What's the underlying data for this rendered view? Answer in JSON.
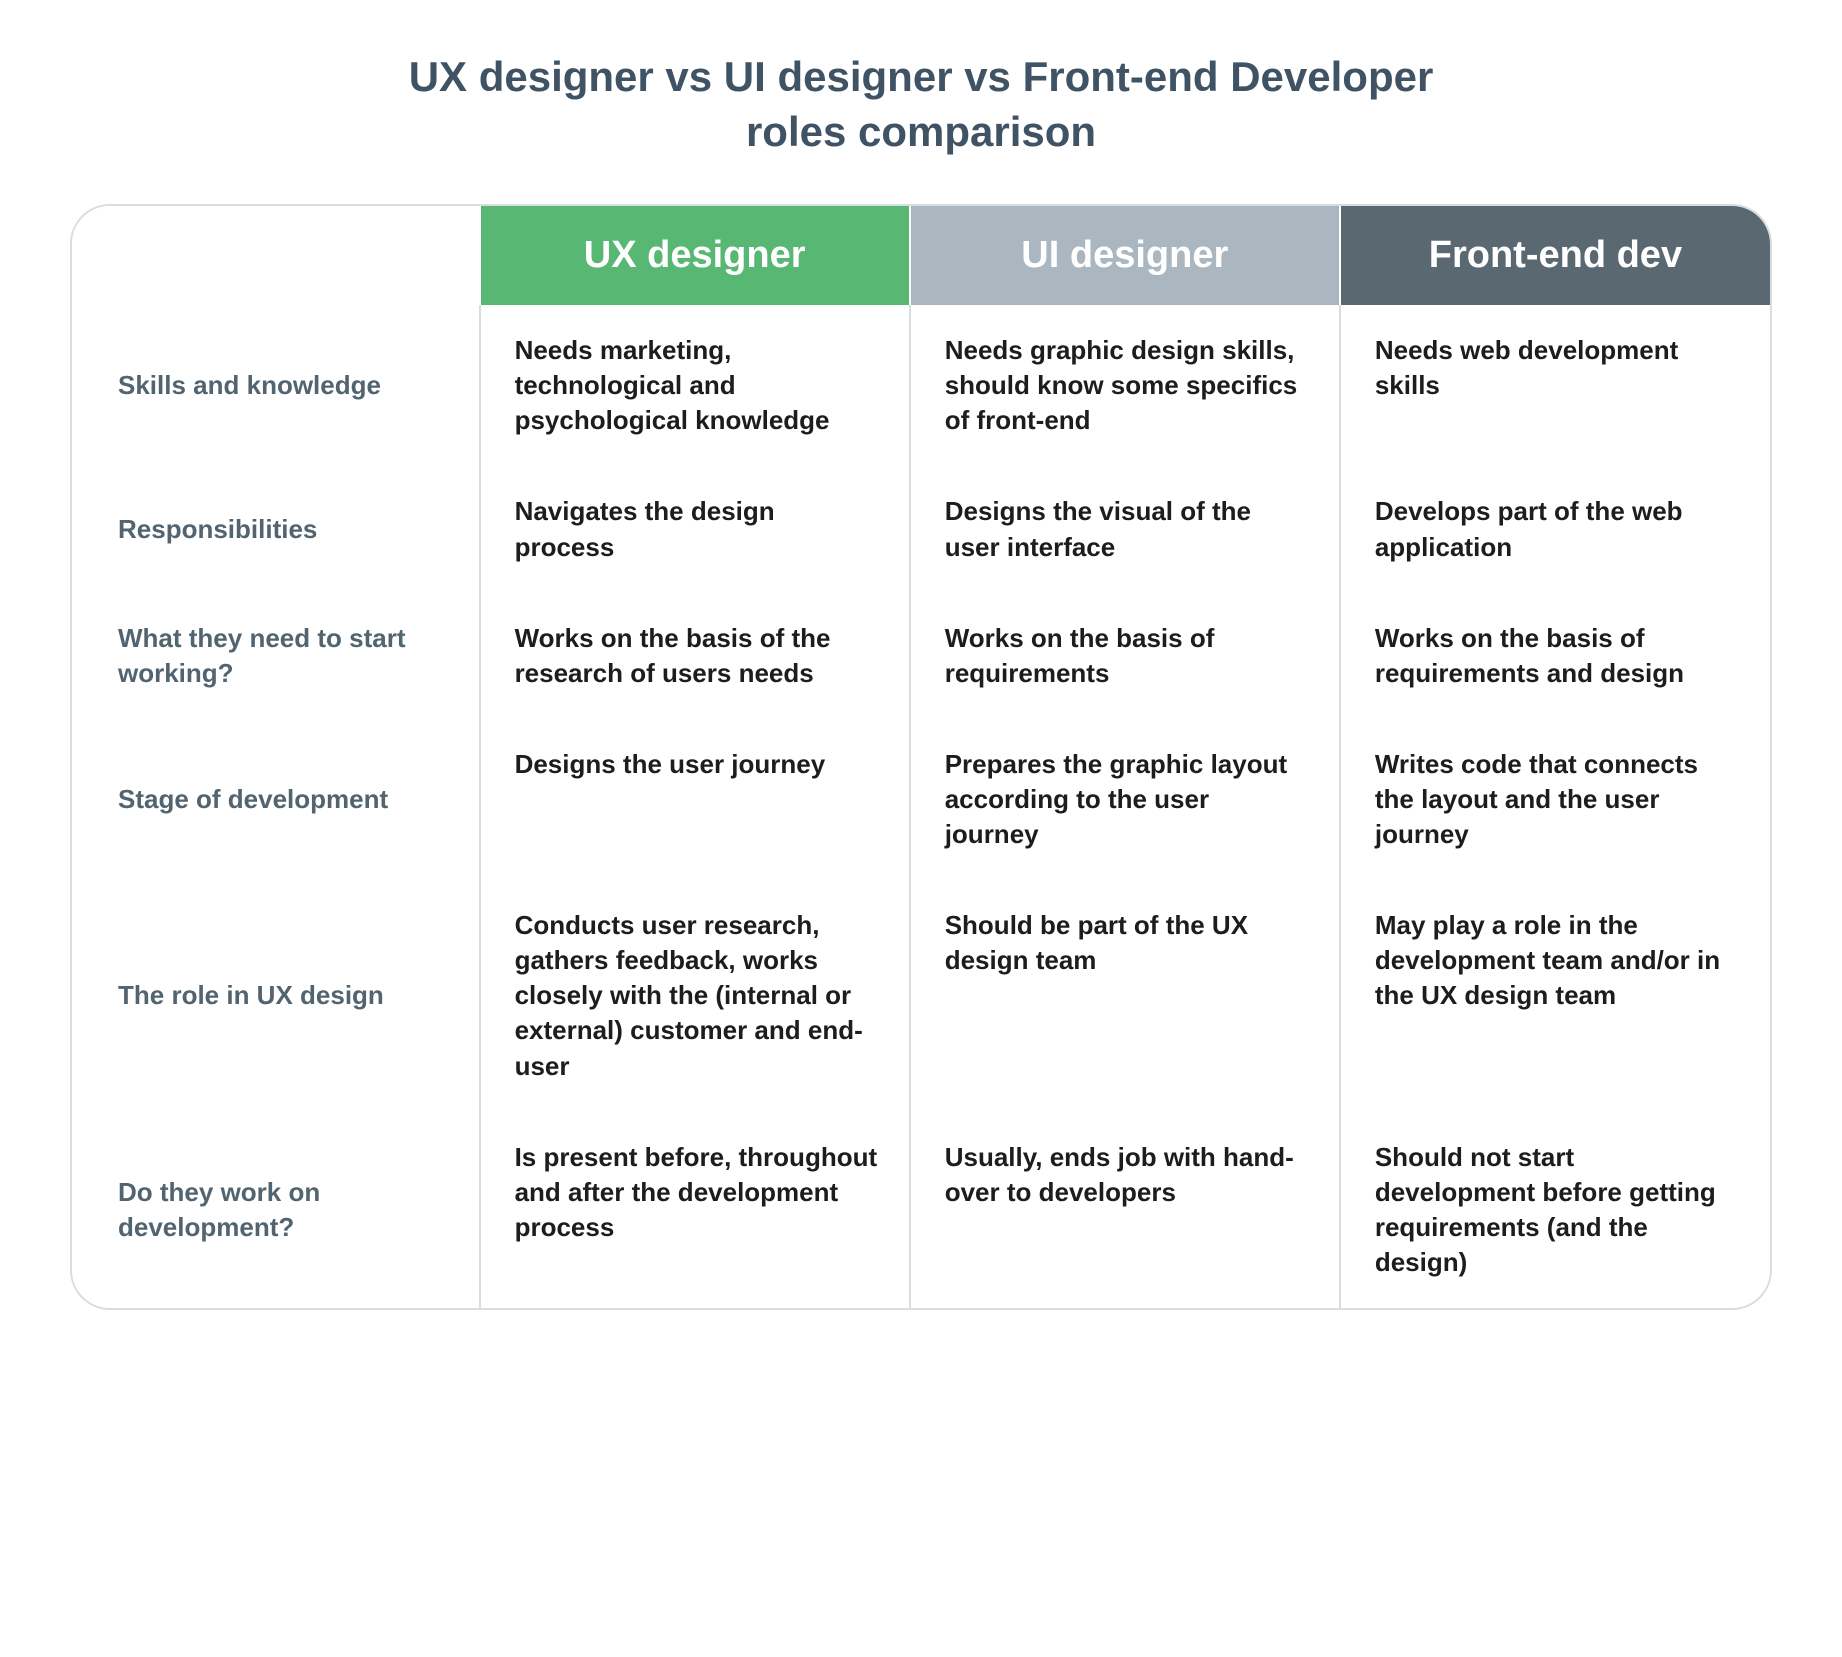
{
  "title_line1": "UX designer vs UI designer vs Front-end Developer",
  "title_line2": "roles comparison",
  "columns": {
    "ux": {
      "label": "UX designer",
      "bg": "#57b773"
    },
    "ui": {
      "label": "UI designer",
      "bg": "#aab7c0"
    },
    "fe": {
      "label": "Front-end dev",
      "bg": "#5a6872"
    }
  },
  "rows": [
    {
      "label": "Skills and knowledge",
      "ux": "Needs marketing, technological and psychological knowledge",
      "ui": "Needs graphic design skills, should know some specifics of front-end",
      "fe": "Needs web development skills"
    },
    {
      "label": "Responsibilities",
      "ux": "Navigates the design process",
      "ui": "Designs the visual of the user interface",
      "fe": "Develops part of the web application"
    },
    {
      "label": "What they need to start working?",
      "ux": "Works on the basis of the research of users needs",
      "ui": "Works on the basis of requirements",
      "fe": "Works on the basis of requirements and design"
    },
    {
      "label": "Stage of development",
      "ux": "Designs the user journey",
      "ui": "Prepares the graphic layout according to the user journey",
      "fe": "Writes code that connects the layout and the user journey"
    },
    {
      "label": "The role in UX design",
      "ux": "Conducts user research, gathers feedback, works closely with the (internal or external) customer and end-user",
      "ui": "Should be part of the UX design team",
      "fe": "May play a role in the development team and/or in the UX design team"
    },
    {
      "label": "Do they work on development?",
      "ux": "Is present before, throughout and after the development process",
      "ui": "Usually, ends job with hand-over to developers",
      "fe": "Should not start development before getting requirements (and the design)"
    }
  ]
}
